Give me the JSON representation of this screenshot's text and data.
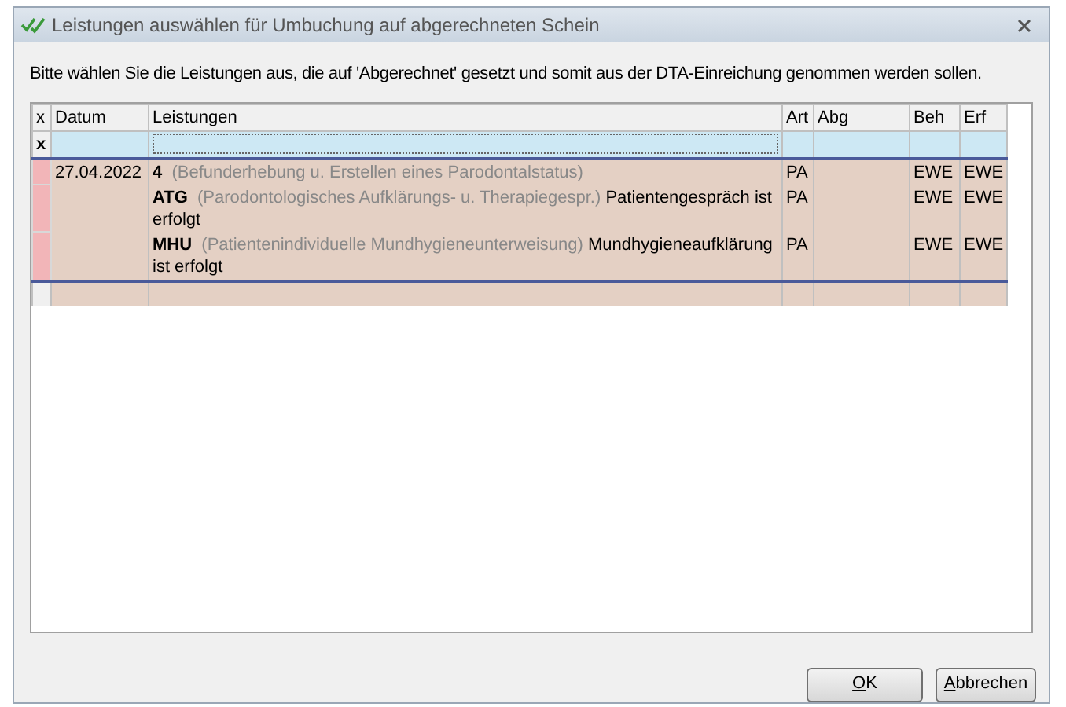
{
  "window": {
    "title": "Leistungen auswählen für Umbuchung auf abgerechneten Schein"
  },
  "instruction": "Bitte wählen Sie die Leistungen aus, die auf 'Abgerechnet' gesetzt und somit aus der DTA-Einreichung genommen werden sollen.",
  "table": {
    "columns": [
      "x",
      "Datum",
      "Leistungen",
      "Art",
      "Abg",
      "Beh",
      "Erf"
    ],
    "filter_row": {
      "marker": "x"
    },
    "rows": [
      {
        "datum": "27.04.2022",
        "code": "4",
        "description": "(Befunderhebung u. Erstellen eines Parodontalstatus)",
        "art": "PA",
        "beh": "EWE",
        "erf": "EWE"
      },
      {
        "code": "ATG",
        "description": "(Parodontologisches Aufklärungs- u. Therapiegespr.)",
        "note": "Patientengespräch ist erfolgt",
        "art": "PA",
        "beh": "EWE",
        "erf": "EWE"
      },
      {
        "code": "MHU",
        "description": "(Patientenindividuelle Mundhygieneunterweisung)",
        "note": "Mundhygieneaufklärung ist erfolgt",
        "art": "PA",
        "beh": "EWE",
        "erf": "EWE"
      }
    ]
  },
  "buttons": [
    {
      "label": "OK",
      "first_letter_underlined": true
    },
    {
      "label": "Abbrechen",
      "first_letter_underlined": true
    }
  ]
}
